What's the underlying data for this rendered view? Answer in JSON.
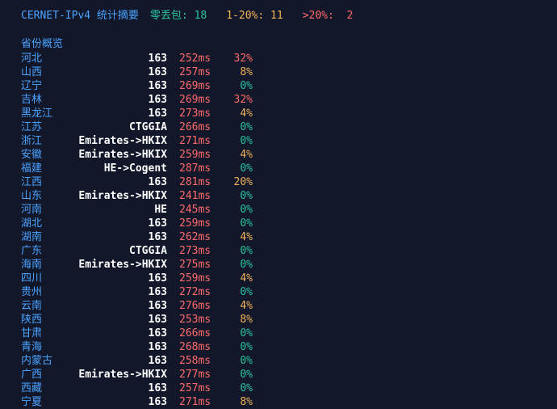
{
  "summary": {
    "title": "CERNET-IPv4 统计摘要",
    "zero_loss": "零丢包: 18",
    "loss_1_20": "1-20%: 11",
    "loss_gt_20": ">20%:  2"
  },
  "colors": {
    "background": "#12172a",
    "accent_blue": "#4aa3ff",
    "green": "#2bc59d",
    "orange": "#f2b35a",
    "red": "#ff6b6b",
    "white": "#ffffff"
  },
  "section": {
    "title": "省份概览"
  },
  "rows": [
    {
      "province": "河北",
      "route": "163",
      "latency": "252ms",
      "loss": "32%",
      "level": "high"
    },
    {
      "province": "山西",
      "route": "163",
      "latency": "257ms",
      "loss": "8%",
      "level": "mid"
    },
    {
      "province": "辽宁",
      "route": "163",
      "latency": "269ms",
      "loss": "0%",
      "level": "zero"
    },
    {
      "province": "吉林",
      "route": "163",
      "latency": "269ms",
      "loss": "32%",
      "level": "high"
    },
    {
      "province": "黑龙江",
      "route": "163",
      "latency": "273ms",
      "loss": "4%",
      "level": "mid"
    },
    {
      "province": "江苏",
      "route": "CTGGIA",
      "latency": "266ms",
      "loss": "0%",
      "level": "zero"
    },
    {
      "province": "浙江",
      "route": "Emirates->HKIX",
      "latency": "271ms",
      "loss": "0%",
      "level": "zero"
    },
    {
      "province": "安徽",
      "route": "Emirates->HKIX",
      "latency": "259ms",
      "loss": "4%",
      "level": "mid"
    },
    {
      "province": "福建",
      "route": "HE->Cogent",
      "latency": "287ms",
      "loss": "0%",
      "level": "zero"
    },
    {
      "province": "江西",
      "route": "163",
      "latency": "281ms",
      "loss": "20%",
      "level": "mid"
    },
    {
      "province": "山东",
      "route": "Emirates->HKIX",
      "latency": "241ms",
      "loss": "0%",
      "level": "zero"
    },
    {
      "province": "河南",
      "route": "HE",
      "latency": "245ms",
      "loss": "0%",
      "level": "zero"
    },
    {
      "province": "湖北",
      "route": "163",
      "latency": "259ms",
      "loss": "0%",
      "level": "zero"
    },
    {
      "province": "湖南",
      "route": "163",
      "latency": "262ms",
      "loss": "4%",
      "level": "mid"
    },
    {
      "province": "广东",
      "route": "CTGGIA",
      "latency": "273ms",
      "loss": "0%",
      "level": "zero"
    },
    {
      "province": "海南",
      "route": "Emirates->HKIX",
      "latency": "275ms",
      "loss": "0%",
      "level": "zero"
    },
    {
      "province": "四川",
      "route": "163",
      "latency": "259ms",
      "loss": "4%",
      "level": "mid"
    },
    {
      "province": "贵州",
      "route": "163",
      "latency": "272ms",
      "loss": "0%",
      "level": "zero"
    },
    {
      "province": "云南",
      "route": "163",
      "latency": "276ms",
      "loss": "4%",
      "level": "mid"
    },
    {
      "province": "陕西",
      "route": "163",
      "latency": "253ms",
      "loss": "8%",
      "level": "mid"
    },
    {
      "province": "甘肃",
      "route": "163",
      "latency": "266ms",
      "loss": "0%",
      "level": "zero"
    },
    {
      "province": "青海",
      "route": "163",
      "latency": "268ms",
      "loss": "0%",
      "level": "zero"
    },
    {
      "province": "内蒙古",
      "route": "163",
      "latency": "258ms",
      "loss": "0%",
      "level": "zero"
    },
    {
      "province": "广西",
      "route": "Emirates->HKIX",
      "latency": "277ms",
      "loss": "0%",
      "level": "zero"
    },
    {
      "province": "西藏",
      "route": "163",
      "latency": "257ms",
      "loss": "0%",
      "level": "zero"
    },
    {
      "province": "宁夏",
      "route": "163",
      "latency": "271ms",
      "loss": "8%",
      "level": "mid"
    }
  ]
}
